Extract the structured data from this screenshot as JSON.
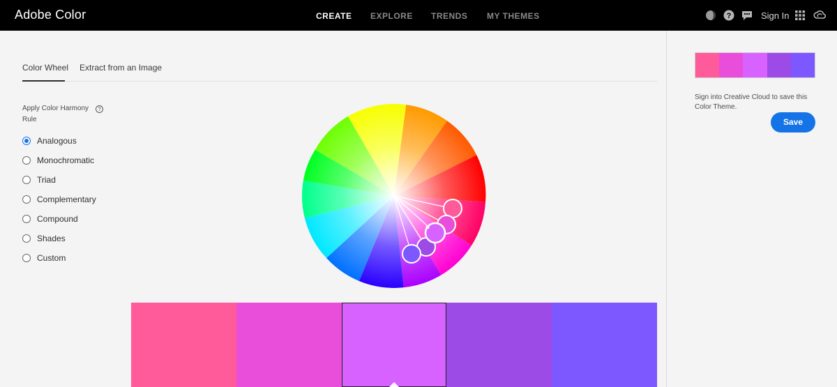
{
  "header": {
    "brand": "Adobe Color",
    "nav": [
      "CREATE",
      "EXPLORE",
      "TRENDS",
      "MY THEMES"
    ],
    "sign_in": "Sign In"
  },
  "tabs": [
    "Color Wheel",
    "Extract from an Image"
  ],
  "harmony": {
    "title": "Apply Color Harmony Rule",
    "help": "?",
    "rules": [
      "Analogous",
      "Monochromatic",
      "Triad",
      "Complementary",
      "Compound",
      "Shades",
      "Custom"
    ],
    "selected": "Analogous"
  },
  "theme_colors": [
    "#FF5A99",
    "#E84EDA",
    "#D862FF",
    "#9C4BE6",
    "#7D57FF"
  ],
  "sidebar": {
    "cc_message": "Sign into Creative Cloud to save this Color Theme.",
    "save_label": "Save"
  },
  "icons": [
    "theme-toggle-icon",
    "help-icon",
    "feedback-icon",
    "apps-grid-icon",
    "creative-cloud-icon"
  ]
}
